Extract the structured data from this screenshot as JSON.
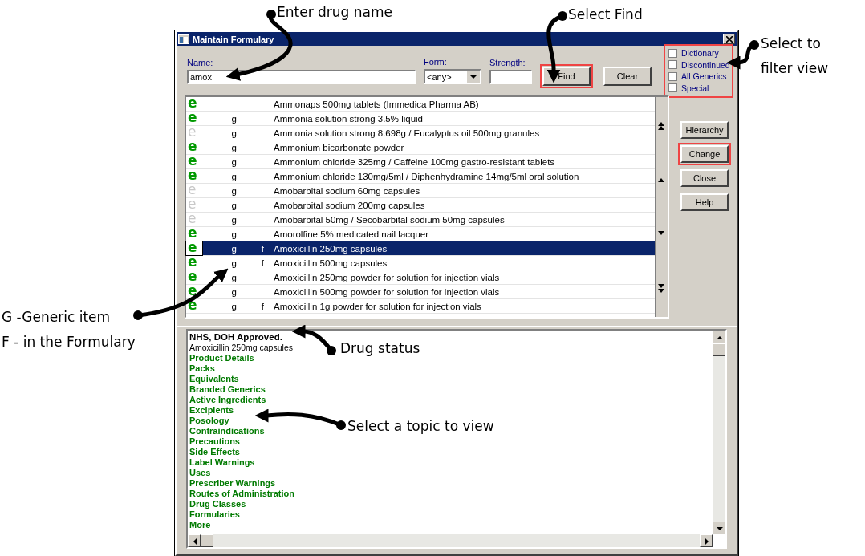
{
  "window": {
    "title": "Maintain Formulary"
  },
  "name_field": {
    "label": "Name:",
    "value": "amox"
  },
  "form_field": {
    "label": "Form:",
    "value": "<any>"
  },
  "strength_field": {
    "label": "Strength:"
  },
  "search_buttons": [
    {
      "label": "Find",
      "highlighted": true
    },
    {
      "label": "Clear",
      "highlighted": false
    }
  ],
  "filters": {
    "highlighted": true,
    "items": [
      {
        "label": "Dictionary",
        "checked": false
      },
      {
        "label": "Discontinued",
        "checked": false
      },
      {
        "label": "All Generics",
        "checked": false
      },
      {
        "label": "Special",
        "checked": false
      }
    ]
  },
  "rows": [
    {
      "icon": "e",
      "active": true,
      "generic": "",
      "formulary": "",
      "name": "Ammonaps 500mg tablets (Immedica Pharma AB)",
      "selected": false
    },
    {
      "icon": "e",
      "active": true,
      "generic": "g",
      "formulary": "",
      "name": "Ammonia solution strong 3.5% liquid",
      "selected": false
    },
    {
      "icon": "e",
      "active": false,
      "generic": "g",
      "formulary": "",
      "name": "Ammonia solution strong 8.698g / Eucalyptus oil 500mg granules",
      "selected": false
    },
    {
      "icon": "e",
      "active": true,
      "generic": "g",
      "formulary": "",
      "name": "Ammonium bicarbonate powder",
      "selected": false
    },
    {
      "icon": "e",
      "active": true,
      "generic": "g",
      "formulary": "",
      "name": "Ammonium chloride 325mg / Caffeine 100mg gastro-resistant tablets",
      "selected": false
    },
    {
      "icon": "e",
      "active": true,
      "generic": "g",
      "formulary": "",
      "name": "Ammonium chloride 130mg/5ml / Diphenhydramine 14mg/5ml oral solution",
      "selected": false
    },
    {
      "icon": "e",
      "active": false,
      "generic": "g",
      "formulary": "",
      "name": "Amobarbital sodium 60mg capsules",
      "selected": false
    },
    {
      "icon": "e",
      "active": false,
      "generic": "g",
      "formulary": "",
      "name": "Amobarbital sodium 200mg capsules",
      "selected": false
    },
    {
      "icon": "e",
      "active": false,
      "generic": "g",
      "formulary": "",
      "name": "Amobarbital 50mg / Secobarbital sodium 50mg capsules",
      "selected": false
    },
    {
      "icon": "e",
      "active": true,
      "generic": "g",
      "formulary": "",
      "name": "Amorolfine 5% medicated nail lacquer",
      "selected": false
    },
    {
      "icon": "e",
      "active": true,
      "generic": "g",
      "formulary": "f",
      "name": "Amoxicillin 250mg capsules",
      "selected": true
    },
    {
      "icon": "e",
      "active": true,
      "generic": "g",
      "formulary": "f",
      "name": "Amoxicillin 500mg capsules",
      "selected": false
    },
    {
      "icon": "e",
      "active": true,
      "generic": "g",
      "formulary": "",
      "name": "Amoxicillin 250mg powder for solution for injection vials",
      "selected": false
    },
    {
      "icon": "e",
      "active": true,
      "generic": "g",
      "formulary": "",
      "name": "Amoxicillin 500mg powder for solution for injection vials",
      "selected": false
    },
    {
      "icon": "e",
      "active": true,
      "generic": "g",
      "formulary": "f",
      "name": "Amoxicillin 1g powder for solution for injection vials",
      "selected": false
    }
  ],
  "side_buttons": [
    {
      "label": "Hierarchy",
      "highlighted": false
    },
    {
      "label": "Change",
      "highlighted": true
    },
    {
      "label": "Close",
      "highlighted": false
    },
    {
      "label": "Help",
      "highlighted": false
    }
  ],
  "details": {
    "status": "NHS, DOH Approved.",
    "product": "Amoxicillin 250mg capsules",
    "topics": [
      "Product Details",
      "Packs",
      "Equivalents",
      "Branded Generics",
      "Active Ingredients",
      "Excipients",
      "Posology",
      "Contraindications",
      "Precautions",
      "Side Effects",
      "Label Warnings",
      "Uses",
      "Prescriber Warnings",
      "Routes of Administration",
      "Drug Classes",
      "Formularies",
      "More"
    ]
  },
  "annotations": [
    {
      "lines": [
        "Enter drug name"
      ]
    },
    {
      "lines": [
        "Select Find"
      ]
    },
    {
      "lines": [
        "Select to",
        "filter view"
      ]
    },
    {
      "lines": [
        "G -Generic item",
        "F - in the Formulary"
      ]
    },
    {
      "lines": [
        "Drug status"
      ]
    },
    {
      "lines": [
        "Select a topic to view"
      ]
    }
  ]
}
